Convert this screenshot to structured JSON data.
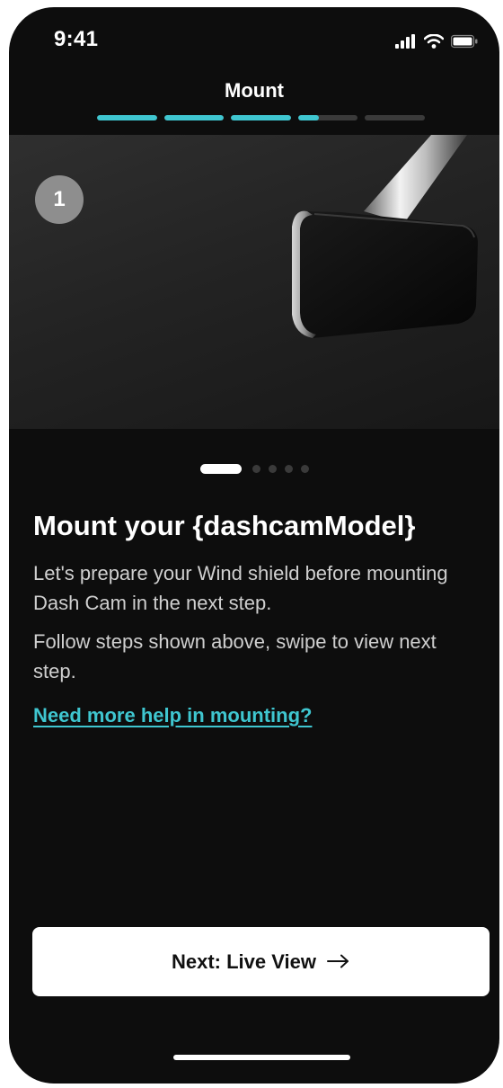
{
  "status_bar": {
    "time": "9:41",
    "icons": [
      "signal-icon",
      "wifi-icon",
      "battery-icon"
    ]
  },
  "header": {
    "title": "Mount",
    "progress_segments": [
      1,
      1,
      1,
      0.35,
      0
    ]
  },
  "hero": {
    "step_number": "1",
    "image": "dashcam-mount-illustration"
  },
  "carousel": {
    "total": 5,
    "active_index": 0
  },
  "content": {
    "title": "Mount your {dashcamModel}",
    "paragraph_1": "Let's prepare your Wind shield before mounting Dash Cam in the next step.",
    "paragraph_2": "Follow steps shown above, swipe to view next step.",
    "help_link": "Need more help in mounting?"
  },
  "footer": {
    "next_label": "Next: Live View",
    "arrow_icon": "arrow-right-icon"
  },
  "colors": {
    "background": "#0d0d0d",
    "accent": "#3fc6d0",
    "button": "#ffffff"
  }
}
